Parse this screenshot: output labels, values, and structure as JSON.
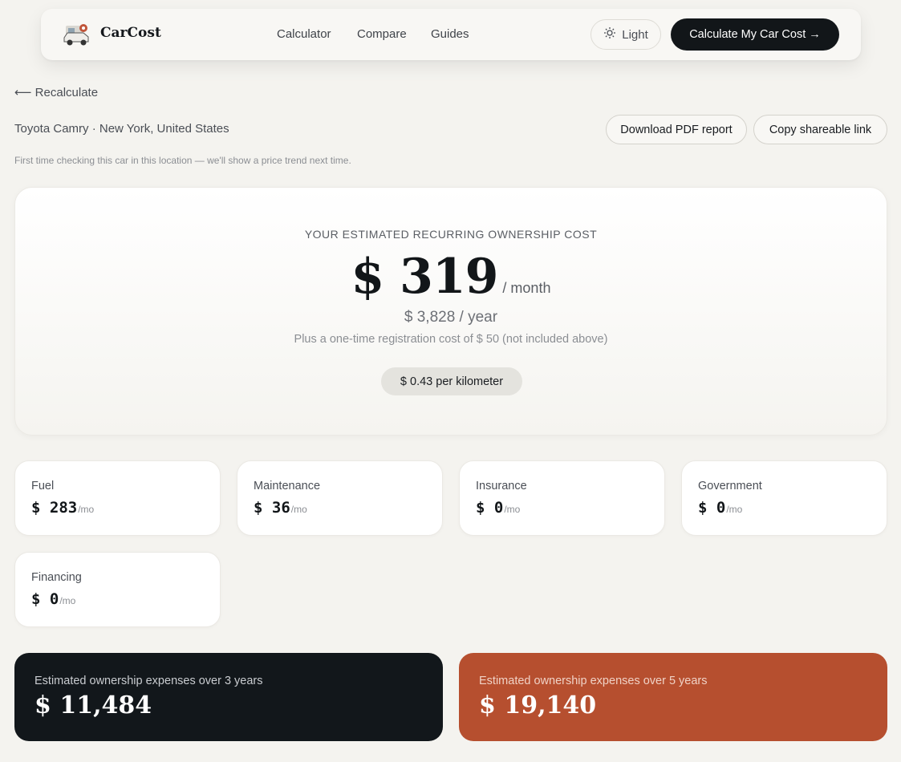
{
  "nav": {
    "brand": "CarCost",
    "links": [
      "Calculator",
      "Compare",
      "Guides"
    ],
    "theme_label": "Light",
    "cta_label": "Calculate My Car Cost →"
  },
  "page": {
    "back_link": "⟵ Recalculate",
    "subtitle": "Toyota Camry · New York, United States",
    "download_label": "Download PDF report",
    "copy_label": "Copy shareable link",
    "note": "First time checking this car in this location — we'll show a price trend next time."
  },
  "hero": {
    "label": "YOUR ESTIMATED RECURRING OWNERSHIP COST",
    "amount": "$ 319",
    "per": "/ month",
    "yearly": "$ 3,828 / year",
    "onetime": "Plus a one-time registration cost of $ 50 (not included above)",
    "per_km": "$ 0.43 per kilometer"
  },
  "categories": [
    {
      "name": "Fuel",
      "amount": "$ 283",
      "unit": "/mo"
    },
    {
      "name": "Maintenance",
      "amount": "$ 36",
      "unit": "/mo"
    },
    {
      "name": "Insurance",
      "amount": "$ 0",
      "unit": "/mo"
    },
    {
      "name": "Government",
      "amount": "$ 0",
      "unit": "/mo"
    },
    {
      "name": "Financing",
      "amount": "$ 0",
      "unit": "/mo"
    }
  ],
  "totals": [
    {
      "label": "Estimated ownership expenses over 3 years",
      "amount": "$ 11,484",
      "color": "#12171b"
    },
    {
      "label": "Estimated ownership expenses over 5 years",
      "amount": "$ 19,140",
      "color": "#b64f2f"
    }
  ],
  "icons": {
    "logo": "car-logo-icon",
    "theme": "sun-icon"
  }
}
